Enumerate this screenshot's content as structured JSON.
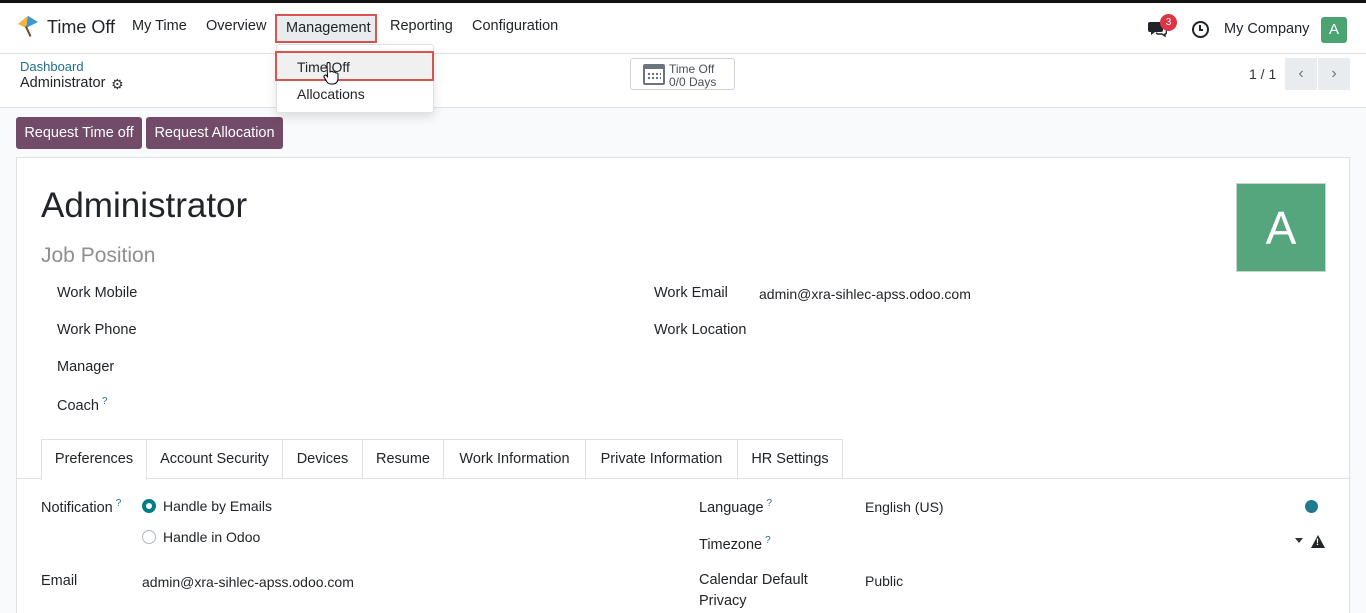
{
  "navbar": {
    "app_title": "Time Off",
    "menu": [
      "My Time",
      "Overview",
      "Management",
      "Reporting",
      "Configuration"
    ],
    "chat_badge": "3",
    "company": "My Company",
    "avatar_letter": "A"
  },
  "dropdown": {
    "items": [
      "Time Off",
      "Allocations"
    ]
  },
  "breadcrumb": {
    "parent": "Dashboard",
    "current": "Administrator"
  },
  "stat_button": {
    "label": "Time Off",
    "value": "0/0 Days"
  },
  "pager": {
    "text": "1 / 1"
  },
  "actions": {
    "request_time_off": "Request Time off",
    "request_allocation": "Request Allocation"
  },
  "employee": {
    "name": "Administrator",
    "job_position_placeholder": "Job Position",
    "avatar_letter": "A",
    "fields_left": [
      "Work Mobile",
      "Work Phone",
      "Manager",
      "Coach"
    ],
    "coach_help": "?",
    "work_email_label": "Work Email",
    "work_email_value": "admin@xra-sihlec-apss.odoo.com",
    "work_location_label": "Work Location"
  },
  "tabs": [
    "Preferences",
    "Account Security",
    "Devices",
    "Resume",
    "Work Information",
    "Private Information",
    "HR Settings"
  ],
  "preferences": {
    "notification_label": "Notification",
    "notification_options": [
      "Handle by Emails",
      "Handle in Odoo"
    ],
    "notification_selected": "Handle by Emails",
    "email_label": "Email",
    "email_value": "admin@xra-sihlec-apss.odoo.com",
    "language_label": "Language",
    "language_value": "English (US)",
    "timezone_label": "Timezone",
    "calendar_privacy_label_1": "Calendar Default",
    "calendar_privacy_label_2": "Privacy",
    "calendar_privacy_value": "Public",
    "help_mark": "?"
  },
  "colors": {
    "primary": "#714b67",
    "link": "#1f6f8b",
    "highlight": "#d9534f",
    "avatar": "#55a57d"
  }
}
